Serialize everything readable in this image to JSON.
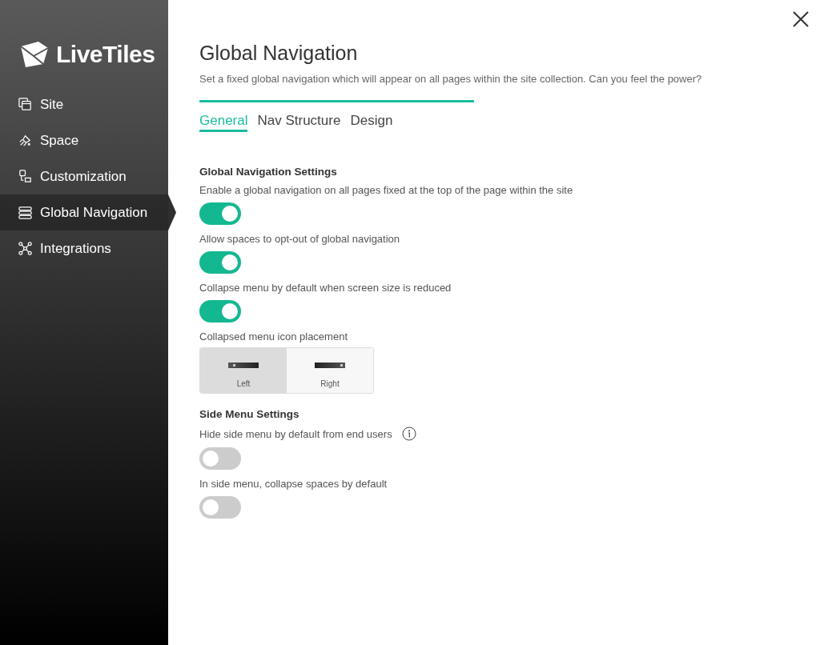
{
  "sidebar": {
    "logo": "LiveTiles",
    "items": [
      {
        "label": "Site",
        "selected": false
      },
      {
        "label": "Space",
        "selected": false
      },
      {
        "label": "Customization",
        "selected": false
      },
      {
        "label": "Global Navigation",
        "selected": true
      },
      {
        "label": "Integrations",
        "selected": false
      }
    ]
  },
  "page": {
    "title": "Global Navigation",
    "description": "Set a fixed global navigation which will appear on all pages within the site collection. Can you feel the power?"
  },
  "tabs": [
    {
      "label": "General",
      "selected": true
    },
    {
      "label": "Nav Structure",
      "selected": false
    },
    {
      "label": "Design",
      "selected": false
    }
  ],
  "sections": [
    {
      "heading": "Global Navigation Settings",
      "settings": [
        {
          "kind": "toggle",
          "label": "Enable a global navigation on all pages fixed at the top of the page within the site",
          "on": true
        },
        {
          "kind": "toggle",
          "label": "Allow spaces to opt-out of global navigation",
          "on": true
        },
        {
          "kind": "toggle",
          "label": "Collapse menu by default when screen size is reduced",
          "on": true
        },
        {
          "kind": "placement",
          "label": "Collapsed menu icon placement",
          "options": [
            {
              "label": "Left",
              "selected": true
            },
            {
              "label": "Right",
              "selected": false
            }
          ]
        }
      ]
    },
    {
      "heading": "Side Menu Settings",
      "settings": [
        {
          "kind": "toggle",
          "label": "Hide side menu by default from end users",
          "on": false,
          "info": true
        },
        {
          "kind": "toggle",
          "label": "In side menu, collapse spaces by default",
          "on": false
        }
      ]
    }
  ]
}
